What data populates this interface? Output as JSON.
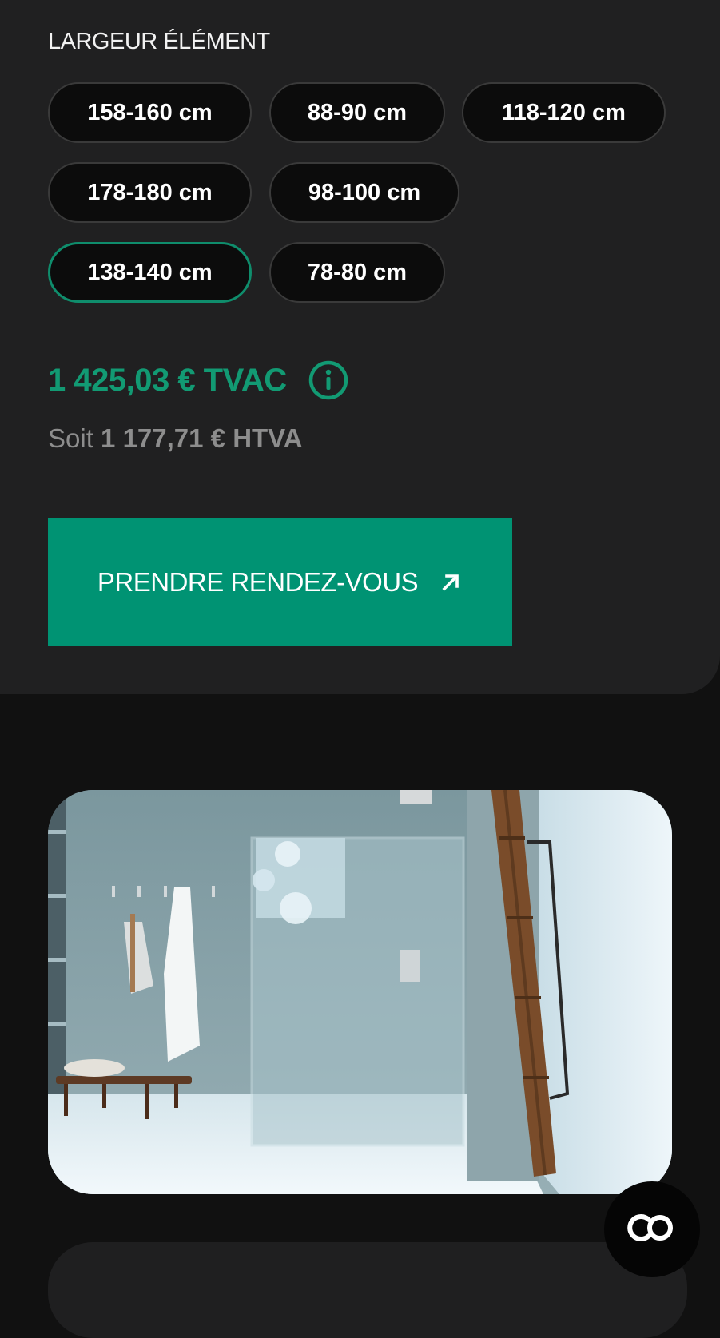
{
  "options": {
    "label": "LARGEUR ÉLÉMENT",
    "items": [
      {
        "label": "158-160 cm",
        "selected": false
      },
      {
        "label": "88-90 cm",
        "selected": false
      },
      {
        "label": "118-120 cm",
        "selected": false
      },
      {
        "label": "178-180 cm",
        "selected": false
      },
      {
        "label": "98-100 cm",
        "selected": false
      },
      {
        "label": "138-140 cm",
        "selected": true
      },
      {
        "label": "78-80 cm",
        "selected": false
      }
    ]
  },
  "price": {
    "tvac": "1 425,03 € TVAC",
    "htva_prefix": "Soit",
    "htva_value": "1 177,71 € HTVA",
    "info_icon": "info-circle-icon"
  },
  "cta": {
    "label": "PRENDRE RENDEZ-VOUS",
    "icon": "arrow-up-right-icon"
  },
  "fab": {
    "icon": "co-logo-icon"
  },
  "colors": {
    "accent": "#009373",
    "price_green": "#129a73",
    "panel_bg": "#202021",
    "page_bg": "#111111",
    "pill_bg": "#0c0c0c"
  }
}
